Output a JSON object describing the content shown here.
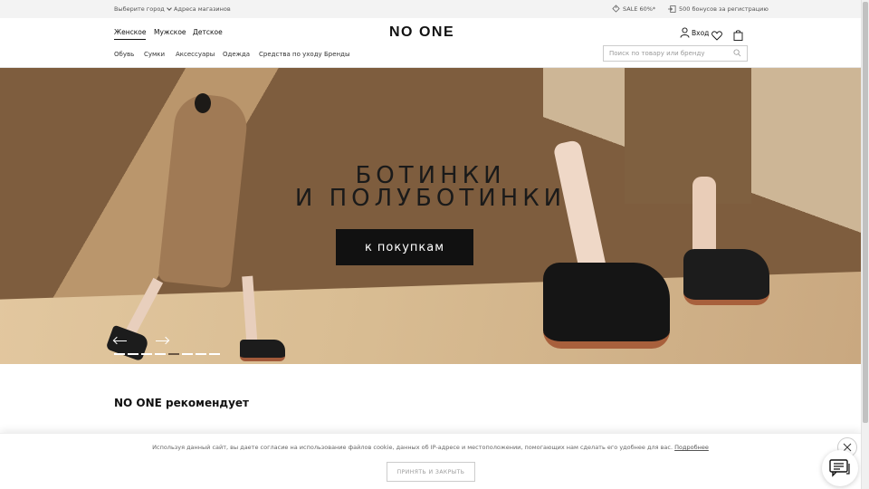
{
  "topbar": {
    "city": "Выберите город",
    "stores": "Адреса магазинов",
    "sale": "SALE 60%*",
    "bonus": "500 бонусов за регистрацию"
  },
  "header": {
    "genders": [
      "Женское",
      "Мужское",
      "Детское"
    ],
    "logo": "NO ONE",
    "login": "Вход",
    "categories": [
      "Обувь",
      "Сумки",
      "Аксессуары",
      "Одежда",
      "Средства по уходу",
      "Бренды"
    ],
    "search_placeholder": "Поиск по товару или бренду"
  },
  "hero": {
    "title_line1": "БОТИНКИ",
    "title_line2": "И ПОЛУБОТИНКИ",
    "cta": "к покупкам",
    "slides_total": 8,
    "slide_active": 1
  },
  "recommend": {
    "title": "NO ONE рекомендует"
  },
  "cookie": {
    "text": "Используя данный сайт, вы даете согласие на использование файлов cookie, данных об IP-адресе и местоположении, помогающих нам сделать его удобнее для вас.",
    "link": "Подробнее",
    "accept": "ПРИНЯТЬ И ЗАКРЫТЬ"
  }
}
